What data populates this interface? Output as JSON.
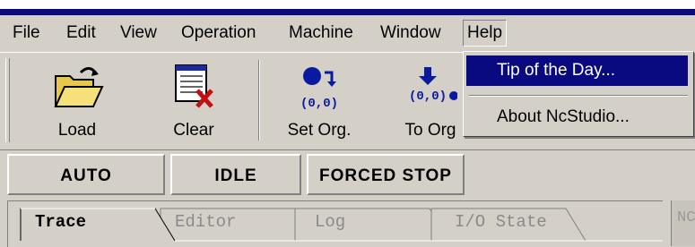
{
  "menu": {
    "items": [
      "File",
      "Edit",
      "View",
      "Operation",
      "Machine",
      "Window",
      "Help"
    ],
    "open_menu": "Help"
  },
  "toolbar": {
    "load_label": "Load",
    "clear_label": "Clear",
    "set_org_label": "Set Org.",
    "set_org_coords": "(0,0)",
    "to_org_label": "To Org",
    "to_org_coords": "(0,0)"
  },
  "status": {
    "mode": "AUTO",
    "state": "IDLE",
    "stop": "FORCED STOP"
  },
  "tabs": [
    "Trace",
    "Editor",
    "Log",
    "I/O State"
  ],
  "right_panel_label": "NC",
  "help_menu": {
    "items": [
      "Tip of the Day...",
      "About NcStudio..."
    ]
  }
}
